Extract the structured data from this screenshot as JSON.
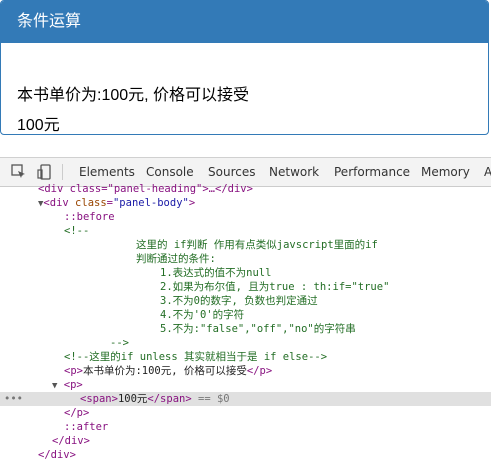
{
  "panel": {
    "heading": "条件运算",
    "line1": "本书单价为:100元, 价格可以接受",
    "line2": "100元"
  },
  "devtools": {
    "tabs": [
      "Elements",
      "Console",
      "Sources",
      "Network",
      "Performance",
      "Memory",
      "A"
    ],
    "tree": {
      "r0": "<div class=\"panel-heading\">…</div>",
      "r1_tag_open": "<div",
      "r1_attr": "class",
      "r1_val": "\"panel-body\"",
      "r1_close": ">",
      "before": "::before",
      "c_open": "<!--",
      "c1": "这里的 if判断 作用有点类似javscript里面的if",
      "c2": "判断通过的条件:",
      "c3": "1.表达式的值不为null",
      "c4": "2.如果为布尔值, 且为true : th:if=\"true\"",
      "c5": "3.不为0的数字, 负数也判定通过",
      "c6": "4.不为'0'的字符",
      "c7": "5.不为:\"false\",\"off\",\"no\"的字符串",
      "c_close": "-->",
      "c8": "<!--这里的if unless 其实就相当于是 if else-->",
      "p1_open": "<p>",
      "p1_text": "本书单价为:100元, 价格可以接受",
      "p1_close": "</p>",
      "p2_open": "<p>",
      "span_open": "<span>",
      "span_text": "100元",
      "span_close": "</span>",
      "sel_marker": "== $0",
      "p2_close": "</p>",
      "after": "::after",
      "div_close": "</div>",
      "div_close2": "</div>"
    }
  }
}
